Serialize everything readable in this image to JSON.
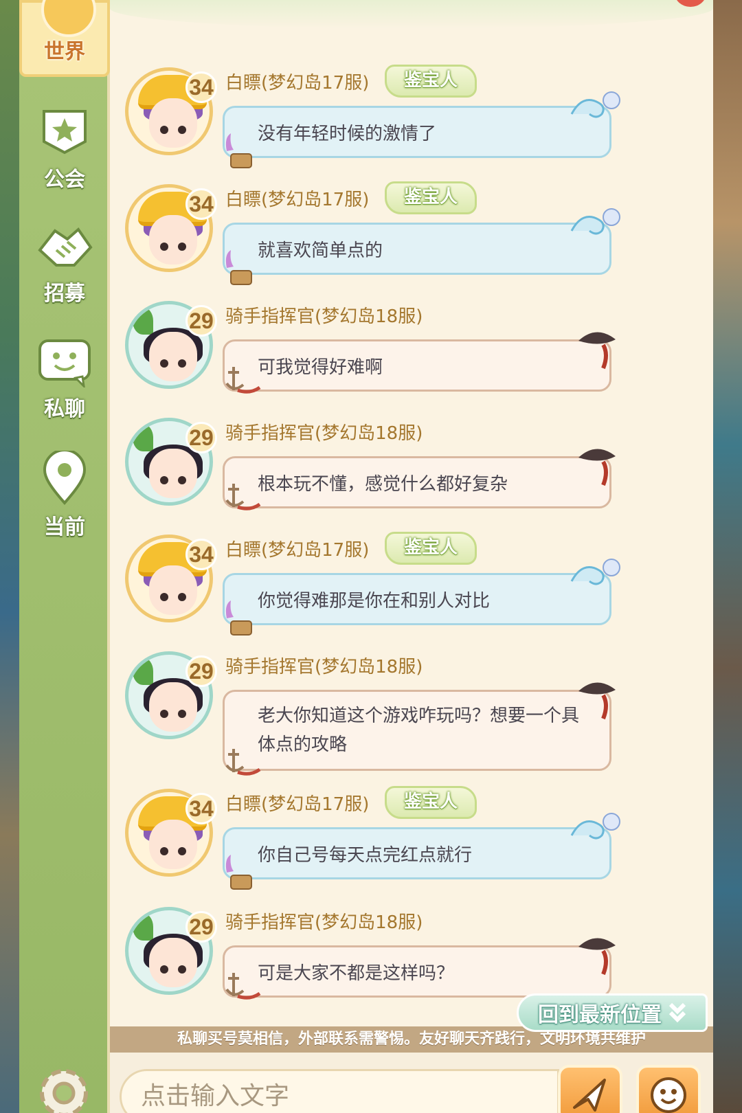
{
  "sidebar": {
    "tabs": [
      {
        "label": "世界",
        "icon": "globe-icon",
        "active": true
      },
      {
        "label": "公会",
        "icon": "guild-banner-icon",
        "active": false
      },
      {
        "label": "招募",
        "icon": "handshake-icon",
        "active": false
      },
      {
        "label": "私聊",
        "icon": "chat-bubble-icon",
        "active": false
      },
      {
        "label": "当前",
        "icon": "location-pin-icon",
        "active": false
      }
    ],
    "settings_icon": "gear-icon"
  },
  "users": {
    "a": {
      "level": "34",
      "name": "白瞟(梦幻岛17服)",
      "badge": "鉴宝人"
    },
    "b": {
      "level": "29",
      "name": "骑手指挥官(梦幻岛18服)"
    }
  },
  "messages": [
    {
      "sender": "a",
      "text": "没有年轻时候的激情了"
    },
    {
      "sender": "a",
      "text": "就喜欢简单点的"
    },
    {
      "sender": "b",
      "text": "可我觉得好难啊"
    },
    {
      "sender": "b",
      "text": "根本玩不懂，感觉什么都好复杂"
    },
    {
      "sender": "a",
      "text": "你觉得难那是你在和别人对比"
    },
    {
      "sender": "b",
      "text": "老大你知道这个游戏咋玩吗？想要一个具体点的攻略"
    },
    {
      "sender": "a",
      "text": "你自己号每天点完红点就行"
    },
    {
      "sender": "b",
      "text": "可是大家不都是这样吗？"
    }
  ],
  "jump_button": {
    "label": "回到最新位置",
    "icon": "double-chevron-down-icon"
  },
  "notice": "私聊买号莫相信，外部联系需警惕。友好聊天齐践行，文明环境共维护",
  "input": {
    "placeholder": "点击输入文字"
  },
  "colors": {
    "sidebar": "#a8c476",
    "panel": "#fbf3e2",
    "bubble_a": "#e2f2f6",
    "bubble_b": "#fdf3ea",
    "name": "#a4772e",
    "accent_orange": "#f19a3a"
  }
}
